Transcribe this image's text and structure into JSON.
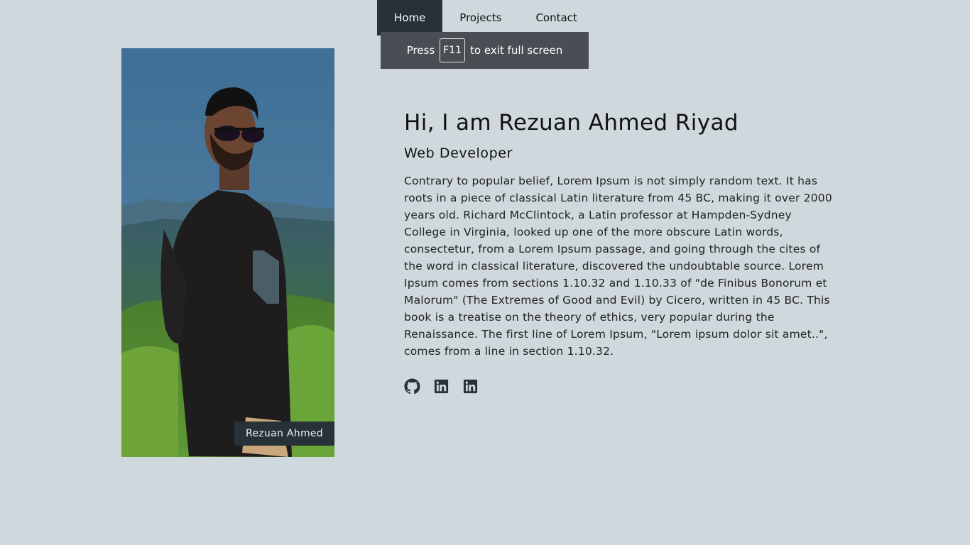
{
  "nav": {
    "items": [
      {
        "label": "Home",
        "active": true
      },
      {
        "label": "Projects",
        "active": false
      },
      {
        "label": "Contact",
        "active": false
      }
    ]
  },
  "fullscreen_notice": {
    "prefix": "Press",
    "key": "F11",
    "suffix": "to exit full screen"
  },
  "profile": {
    "caption": "Rezuan Ahmed"
  },
  "hero": {
    "title": "Hi, I am Rezuan Ahmed Riyad",
    "subtitle": "Web Developer",
    "bio": "Contrary to popular belief, Lorem Ipsum is not simply random text. It has roots in a piece of classical Latin literature from 45 BC, making it over 2000 years old. Richard McClintock, a Latin professor at Hampden-Sydney College in Virginia, looked up one of the more obscure Latin words, consectetur, from a Lorem Ipsum passage, and going through the cites of the word in classical literature, discovered the undoubtable source. Lorem Ipsum comes from sections 1.10.32 and 1.10.33 of \"de Finibus Bonorum et Malorum\" (The Extremes of Good and Evil) by Cicero, written in 45 BC. This book is a treatise on the theory of ethics, very popular during the Renaissance. The first line of Lorem Ipsum, \"Lorem ipsum dolor sit amet..\", comes from a line in section 1.10.32."
  },
  "social": {
    "icons": [
      "github-icon",
      "linkedin-icon",
      "linkedin-icon"
    ]
  },
  "colors": {
    "background": "#cfd8dc",
    "nav_active": "#263238",
    "banner": "#4a4e54",
    "icon": "#263238"
  }
}
